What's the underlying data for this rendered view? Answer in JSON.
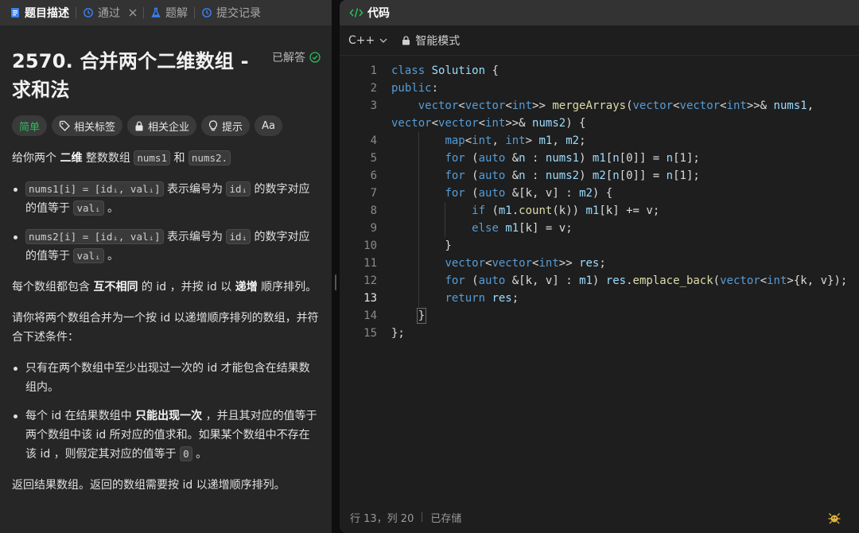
{
  "left_tabs": [
    {
      "label": "题目描述",
      "icon": "document-icon"
    },
    {
      "label": "通过",
      "icon": "history-icon"
    },
    {
      "label": "题解",
      "icon": "flask-icon"
    },
    {
      "label": "提交记录",
      "icon": "history-icon"
    }
  ],
  "problem": {
    "title": "2570. 合并两个二维数组 - 求和法",
    "solved_label": "已解答",
    "difficulty": "简单",
    "tags": {
      "related_tags": "相关标签",
      "related_companies": "相关企业",
      "hint": "提示",
      "font": "Aa"
    }
  },
  "desc": {
    "p1_a": "给你两个 ",
    "p1_b": "二维",
    "p1_c": " 整数数组 ",
    "p1_code1": "nums1",
    "p1_d": " 和 ",
    "p1_code2": "nums2.",
    "li1_code1": "nums1[i] = [idᵢ, valᵢ]",
    "li1_a": " 表示编号为 ",
    "li1_code2": "idᵢ",
    "li1_b": " 的数字对应的值等于 ",
    "li1_code3": "valᵢ",
    "li1_c": " 。",
    "li2_code1": "nums2[i] = [idᵢ, valᵢ]",
    "li2_a": " 表示编号为 ",
    "li2_code2": "idᵢ",
    "li2_b": " 的数字对应的值等于 ",
    "li2_code3": "valᵢ",
    "li2_c": " 。",
    "p2_a": "每个数组都包含 ",
    "p2_b": "互不相同",
    "p2_c": " 的 id ，并按 id 以 ",
    "p2_d": "递增",
    "p2_e": " 顺序排列。",
    "p3": "请你将两个数组合并为一个按 id 以递增顺序排列的数组，并符合下述条件：",
    "li3": "只有在两个数组中至少出现过一次的 id 才能包含在结果数组内。",
    "li4_a": "每个 id 在结果数组中 ",
    "li4_b": "只能出现一次",
    "li4_c": " ，并且其对应的值等于两个数组中该 id 所对应的值求和。如果某个数组中不存在该 id ，则假定其对应的值等于 ",
    "li4_code": "0",
    "li4_d": " 。",
    "p4": "返回结果数组。返回的数组需要按 id 以递增顺序排列。"
  },
  "code_panel": {
    "tab_label": "代码",
    "language": "C++",
    "mode": "智能模式",
    "current_line": 13,
    "lines": [
      "class Solution {",
      "public:",
      "    vector<vector<int>> mergeArrays(vector<vector<int>>& nums1,",
      "vector<vector<int>>& nums2) {",
      "        map<int, int> m1, m2;",
      "        for (auto &n : nums1) m1[n[0]] = n[1];",
      "        for (auto &n : nums2) m2[n[0]] = n[1];",
      "        for (auto &[k, v] : m2) {",
      "            if (m1.count(k)) m1[k] += v;",
      "            else m1[k] = v;",
      "        }",
      "        vector<vector<int>> res;",
      "        for (auto &[k, v] : m1) res.emplace_back(vector<int>{k, v});",
      "        return res;",
      "    }",
      "};"
    ],
    "line_numbers": [
      "1",
      "2",
      "3",
      "",
      "4",
      "5",
      "6",
      "7",
      "8",
      "9",
      "10",
      "11",
      "12",
      "13",
      "14",
      "15"
    ]
  },
  "status": {
    "position": "行 13，列 20",
    "saved": "已存储"
  }
}
